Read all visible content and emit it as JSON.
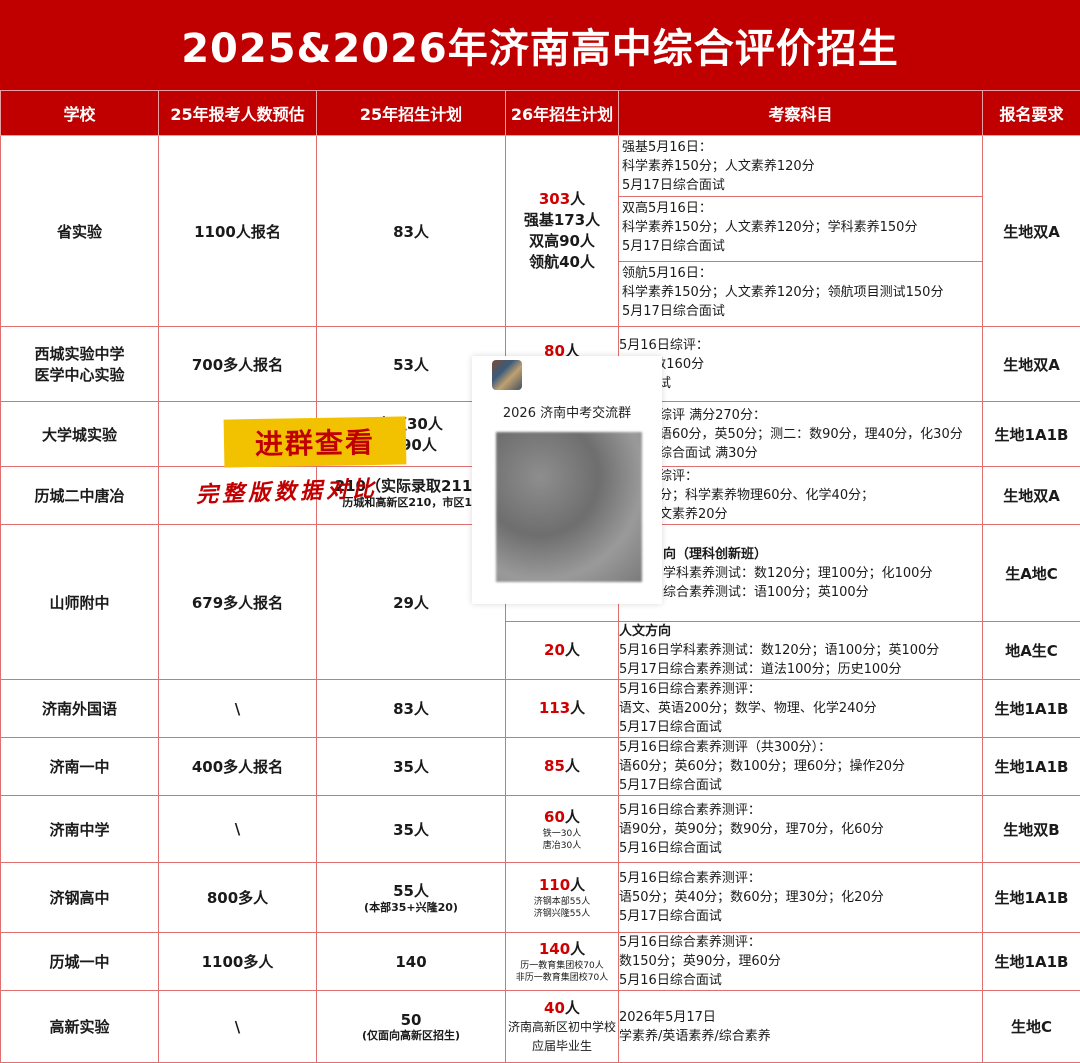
{
  "title": "2025&2026年济南高中综合评价招生",
  "headers": [
    "学校",
    "25年报考人数预估",
    "25年招生计划",
    "26年招生计划",
    "考察科目",
    "报名要求"
  ],
  "rows": [
    {
      "school": "省实验",
      "est": "1100人报名",
      "plan25": "83人",
      "plan26_main": "303",
      "plan26_unit": "人",
      "plan26_lines": [
        "强基173人",
        "双高90人",
        "领航40人"
      ],
      "subjects": [
        [
          "强基5月16日：",
          "科学素养150分；人文素养120分",
          "5月17日综合面试"
        ],
        [
          "双高5月16日：",
          "科学素养150分；人文素养120分；学科素养150分",
          "5月17日综合面试"
        ],
        [
          "领航5月16日：",
          "科学素养150分；人文素养120分；领航项目测试150分",
          "5月17日综合面试"
        ]
      ],
      "req": "生地双A"
    },
    {
      "school": "西城实验中学\n医学中心实验",
      "school_lines": [
        "西城实验中学",
        "医学中心实验"
      ],
      "est": "700多人报名",
      "plan25": "53人",
      "plan26_main": "80",
      "plan26_unit": "人",
      "subjects": [
        [
          "5月16日综评：",
          "0分；数160分",
          "综合面试"
        ]
      ],
      "req": "生地双A"
    },
    {
      "school": "大学城实验",
      "est": "",
      "plan25_lines": [
        "市区30人",
        "90人"
      ],
      "subjects": [
        [
          "综评 满分270分：",
          "语60分，英50分；测二：数90分，理40分，化30分",
          "综合面试 满30分"
        ]
      ],
      "req": "生地1A1B"
    },
    {
      "school": "历城二中唐冶",
      "est": "",
      "plan25_lines": [
        "210（实际录取211人",
        "历城和高新区210，市区10"
      ],
      "subjects": [
        [
          "综评：",
          "分；科学素养物理60分、化学40分；",
          "文素养20分"
        ]
      ],
      "req": "生地双A"
    },
    {
      "school": "山师附中",
      "est": "679多人报名",
      "plan25": "29人",
      "subjects_a": [
        "向（理科创新班）",
        "学科素养测试：数120分；理100分；化100分",
        "综合素养测试：语100分；英100分"
      ],
      "req_a": "生A地C",
      "plan26_b_main": "20",
      "plan26_b_unit": "人",
      "subjects_b": [
        "人文方向",
        "5月16日学科素养测试：数120分；语100分；英100分",
        "5月17日综合素养测试：道法100分；历史100分"
      ],
      "req_b": "地A生C"
    },
    {
      "school": "济南外国语",
      "est": "\\",
      "plan25": "83人",
      "plan26_main": "113",
      "plan26_unit": "人",
      "subjects": [
        [
          "5月16日综合素养测评：",
          "语文、英语200分；数学、物理、化学240分",
          "5月17日综合面试"
        ]
      ],
      "req": "生地1A1B"
    },
    {
      "school": "济南一中",
      "est": "400多人报名",
      "plan25": "35人",
      "plan26_main": "85",
      "plan26_unit": "人",
      "subjects": [
        [
          "5月16日综合素养测评（共300分）：",
          "语60分；英60分；数100分；理60分；操作20分",
          "5月17日综合面试"
        ]
      ],
      "req": "生地1A1B"
    },
    {
      "school": "济南中学",
      "est": "\\",
      "plan25": "35人",
      "plan26_main": "60",
      "plan26_unit": "人",
      "plan26_small": [
        "铁一30人",
        "唐冶30人"
      ],
      "subjects": [
        [
          "5月16日综合素养测评：",
          "语90分，英90分；数90分，理70分，化60分",
          "5月16日综合面试"
        ]
      ],
      "req": "生地双B"
    },
    {
      "school": "济钢高中",
      "est": "800多人",
      "plan25": "55人",
      "plan25_sub": "(本部35+兴隆20)",
      "plan26_main": "110",
      "plan26_unit": "人",
      "plan26_small": [
        "济钢本部55人",
        "济钢兴隆55人"
      ],
      "subjects": [
        [
          "5月16日综合素养测评：",
          "语50分；英40分；数60分；理30分；化20分",
          "5月17日综合面试"
        ]
      ],
      "req": "生地1A1B"
    },
    {
      "school": "历城一中",
      "est": "1100多人",
      "plan25": "140",
      "plan26_main": "140",
      "plan26_unit": "人",
      "plan26_small": [
        "历一教育集团校70人",
        "非历一教育集团校70人"
      ],
      "subjects": [
        [
          "5月16日综合素养测评：",
          "数150分；英90分，理60分",
          "5月16日综合面试"
        ]
      ],
      "req": "生地1A1B"
    },
    {
      "school": "高新实验",
      "est": "\\",
      "plan25": "50",
      "plan25_sub": "(仅面向高新区招生)",
      "plan26_main": "40",
      "plan26_unit": "人",
      "plan26_lines_small": [
        "济南高新区初中学校",
        "应届毕业生"
      ],
      "subjects": [
        [
          "2026年5月17日",
          "学素养/英语素养/综合素养"
        ]
      ],
      "req": "生地C"
    }
  ],
  "overlay": {
    "qr_title": "2026 济南中考交流群",
    "watermark_1": "进群查看",
    "watermark_2": "完整版数据对比"
  },
  "colors": {
    "header_red": "#c00000",
    "number_red": "#d00000",
    "watermark_yellow": "#f2c200",
    "border": "#e07070"
  }
}
